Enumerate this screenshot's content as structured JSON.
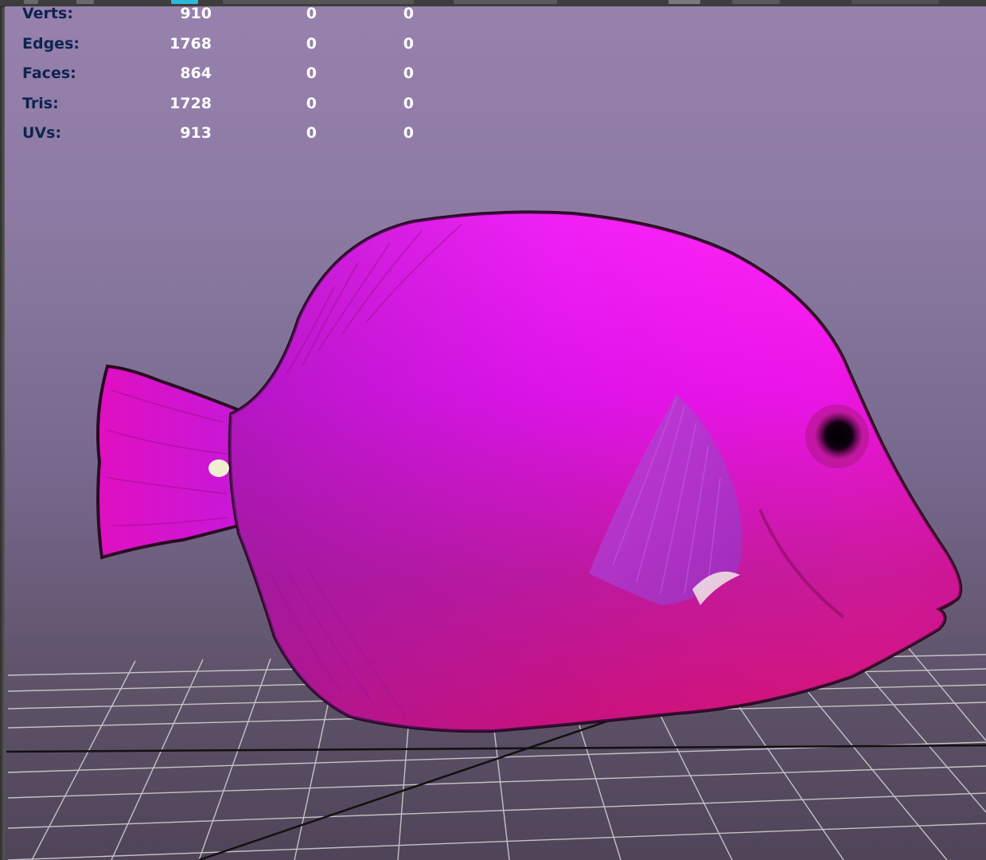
{
  "hud": {
    "rows": [
      {
        "label": "Verts:",
        "v1": "910",
        "v2": "0",
        "v3": "0"
      },
      {
        "label": "Edges:",
        "v1": "1768",
        "v2": "0",
        "v3": "0"
      },
      {
        "label": "Faces:",
        "v1": "864",
        "v2": "0",
        "v3": "0"
      },
      {
        "label": "Tris:",
        "v1": "1728",
        "v2": "0",
        "v3": "0"
      },
      {
        "label": "UVs:",
        "v1": "913",
        "v2": "0",
        "v3": "0"
      }
    ]
  },
  "colors": {
    "hud_label": "#0f2350",
    "hud_value": "#ffffff",
    "fish_body": "#e010e8",
    "fish_belly": "#d0106a",
    "grid_line": "#d8d8d8",
    "axis_line": "#111111"
  },
  "scene": {
    "object": "fish-model",
    "grid": true
  }
}
